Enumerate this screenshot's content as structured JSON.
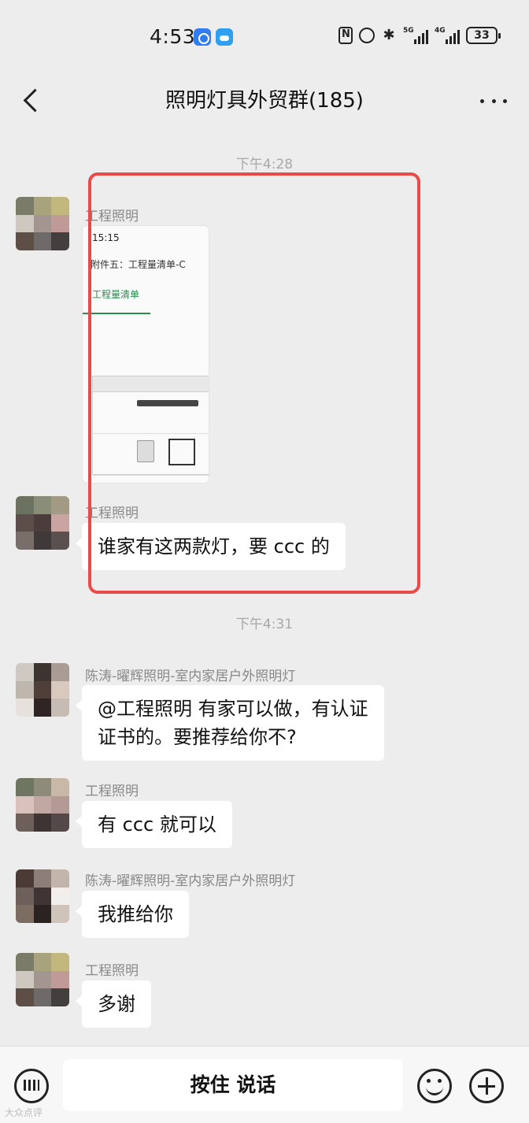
{
  "status_bar": {
    "time": "4:53",
    "network_1": "5G",
    "network_2": "4G",
    "battery": "33"
  },
  "nav": {
    "title": "照明灯具外贸群(185)"
  },
  "timestamps": [
    "下午4:28",
    "下午4:31"
  ],
  "messages": [
    {
      "sender": "工程照明",
      "type": "image",
      "thumbnail": {
        "time": "15:15",
        "heading": "附件五：工程量清单-C",
        "tab": "工程量清单"
      }
    },
    {
      "sender": "工程照明",
      "type": "text",
      "text": "谁家有这两款灯，要 ccc 的"
    },
    {
      "sender": "陈涛-曜辉照明-室内家居户外照明灯",
      "type": "text",
      "line1": "@工程照明  有家可以做，有认证",
      "line2": "证书的。要推荐给你不?"
    },
    {
      "sender": "工程照明",
      "type": "text",
      "text": "有 ccc 就可以"
    },
    {
      "sender": "陈涛-曜辉照明-室内家居户外照明灯",
      "type": "text",
      "text": "我推给你"
    },
    {
      "sender": "工程照明",
      "type": "text",
      "text": "多谢"
    }
  ],
  "bottom_bar": {
    "talk_label": "按住 说话"
  },
  "watermark": "大众点评",
  "colors": {
    "highlight": "#e94b4b",
    "background": "#ededed",
    "bubble": "#ffffff"
  }
}
